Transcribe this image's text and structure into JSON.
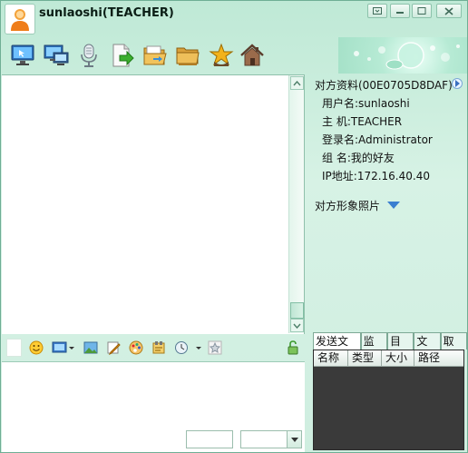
{
  "window": {
    "title": "sunlaoshi(TEACHER)"
  },
  "toolbar": [
    {
      "name": "remote-desktop-icon"
    },
    {
      "name": "screen-broadcast-icon"
    },
    {
      "name": "microphone-icon"
    },
    {
      "name": "send-file-icon"
    },
    {
      "name": "open-folder-icon"
    },
    {
      "name": "shared-folder-icon"
    },
    {
      "name": "star-award-icon"
    },
    {
      "name": "home-icon"
    }
  ],
  "profile": {
    "heading": "对方资料(00E0705D8DAF)",
    "username": "用户名:sunlaoshi",
    "host": "主  机:TEACHER",
    "login": "登录名:Administrator",
    "group": "组  名:我的好友",
    "ip": "IP地址:172.16.40.40",
    "photo_label": "对方形象照片"
  },
  "file_tabs": [
    "发送文件",
    "监视",
    "目录",
    "文件",
    "取消"
  ],
  "file_columns": [
    "名称",
    "类型",
    "大小",
    "路径"
  ],
  "colors": {
    "accent": "#cfeee0",
    "border": "#6fae95"
  }
}
